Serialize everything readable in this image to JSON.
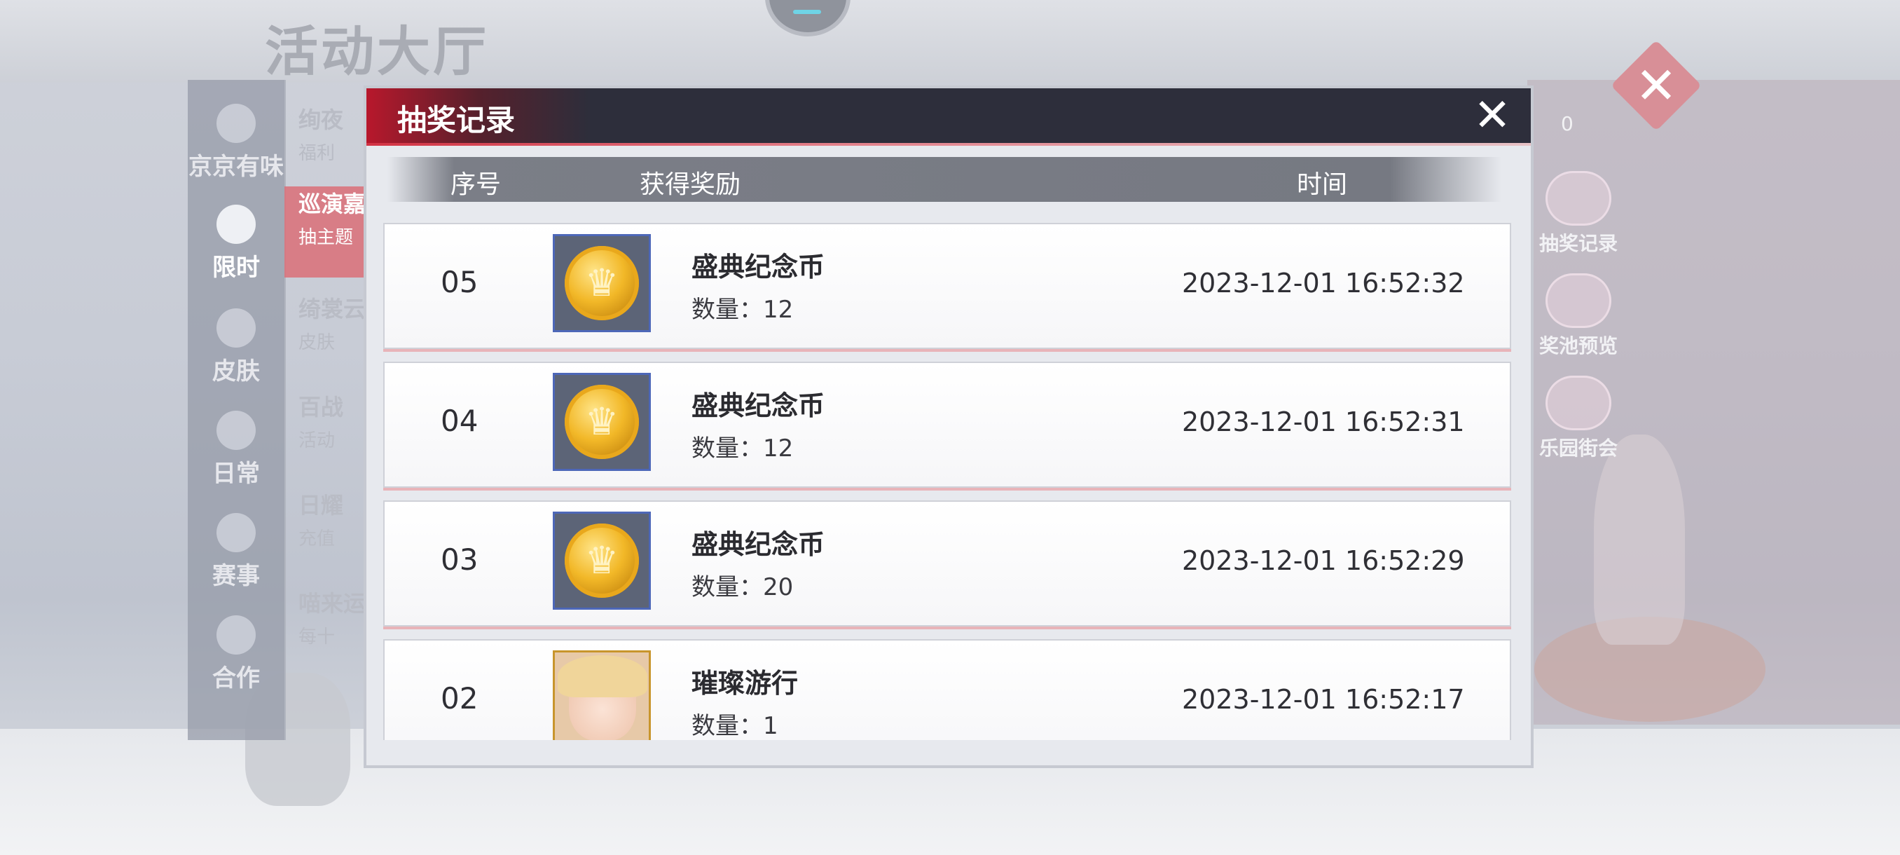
{
  "background": {
    "page_title": "活动大厅",
    "counter": "0",
    "sidebar": [
      {
        "label": "京京有味",
        "icon": "chef-hat-icon"
      },
      {
        "label": "限时",
        "icon": "clock-icon",
        "active": true
      },
      {
        "label": "皮肤",
        "icon": "bow-icon"
      },
      {
        "label": "日常",
        "icon": "gift-icon"
      },
      {
        "label": "赛事",
        "icon": "trophy-icon"
      },
      {
        "label": "合作",
        "icon": "handshake-icon"
      }
    ],
    "menu": [
      {
        "title": "绚夜",
        "sub": "福利"
      },
      {
        "title": "巡演嘉",
        "sub": "抽主题",
        "active": true
      },
      {
        "title": "绮裳云",
        "sub": "皮肤"
      },
      {
        "title": "百战",
        "sub": "活动"
      },
      {
        "title": "日耀",
        "sub": "充值"
      },
      {
        "title": "喵来运",
        "sub": "每十"
      }
    ],
    "right_buttons": [
      {
        "label": "抽奖记录",
        "icon": "gift-box-icon"
      },
      {
        "label": "奖池预览",
        "icon": "list-icon"
      },
      {
        "label": "乐园街会",
        "icon": "shop-icon"
      }
    ]
  },
  "dialog": {
    "title": "抽奖记录",
    "close_icon": "close-icon",
    "columns": {
      "index": "序号",
      "reward": "获得奖励",
      "time": "时间"
    },
    "qty_prefix": "数量：",
    "rows": [
      {
        "index": "05",
        "name": "盛典纪念币",
        "qty": "数量：12",
        "time": "2023-12-01 16:52:32",
        "icon": "coin-icon"
      },
      {
        "index": "04",
        "name": "盛典纪念币",
        "qty": "数量：12",
        "time": "2023-12-01 16:52:31",
        "icon": "coin-icon"
      },
      {
        "index": "03",
        "name": "盛典纪念币",
        "qty": "数量：20",
        "time": "2023-12-01 16:52:29",
        "icon": "coin-icon"
      },
      {
        "index": "02",
        "name": "璀璨游行",
        "qty": "数量：1",
        "time": "2023-12-01 16:52:17",
        "icon": "character-portrait-icon"
      }
    ]
  }
}
